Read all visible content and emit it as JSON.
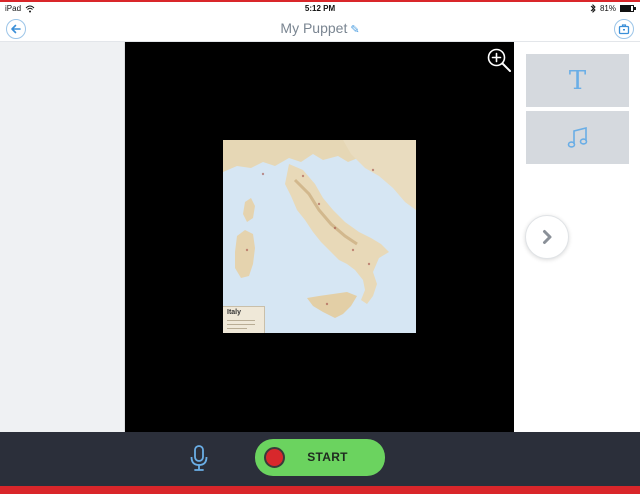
{
  "status_bar": {
    "device": "iPad",
    "time": "5:12 PM",
    "battery": "81%",
    "battery_level": 0.81
  },
  "nav": {
    "title": "My Puppet"
  },
  "stage": {
    "map": {
      "label": "Italy"
    }
  },
  "tiles": {
    "text_glyph": "T"
  },
  "toolbar": {
    "start_label": "START"
  },
  "colors": {
    "accent": "#4a9de0",
    "stage_bg": "#000000",
    "start_green": "#6bd35f",
    "record_red": "#d8282c",
    "toolbar_bg": "#2b2f3a",
    "frame_red": "#d9262a"
  }
}
